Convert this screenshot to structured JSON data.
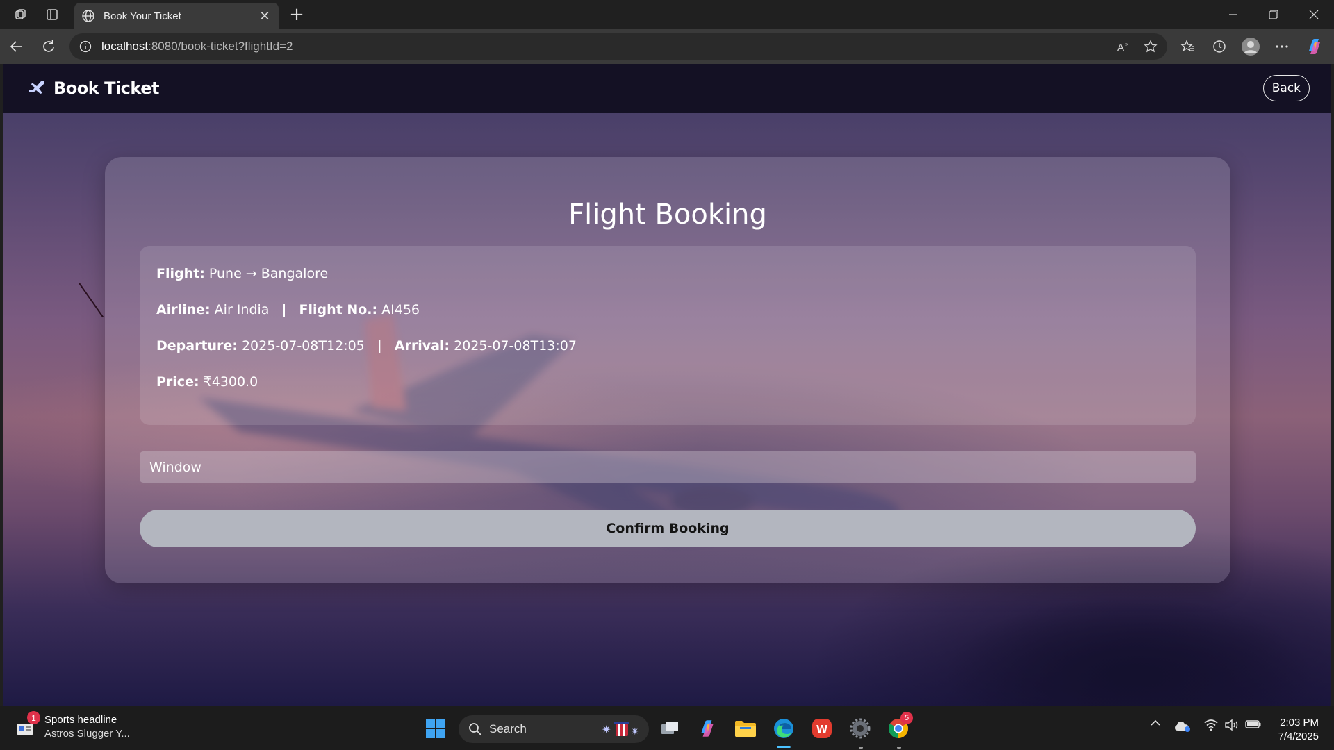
{
  "browser": {
    "tab_title": "Book Your Ticket",
    "url_host": "localhost",
    "url_rest": ":8080/book-ticket?flightId=2"
  },
  "navbar": {
    "brand": "Book Ticket",
    "back_label": "Back"
  },
  "card": {
    "title": "Flight Booking",
    "flight_label": "Flight:",
    "flight_value": "Pune → Bangalore",
    "airline_label": "Airline:",
    "airline_value": "Air India",
    "flight_no_label": "Flight No.:",
    "flight_no_value": "AI456",
    "departure_label": "Departure:",
    "departure_value": "2025-07-08T12:05",
    "arrival_label": "Arrival:",
    "arrival_value": "2025-07-08T13:07",
    "price_label": "Price:",
    "price_value": "₹4300.0",
    "separator": "|",
    "seat_selected": "Window",
    "confirm_label": "Confirm Booking"
  },
  "taskbar": {
    "news_badge": "1",
    "news_title": "Sports headline",
    "news_sub": "Astros Slugger Y...",
    "search_label": "Search",
    "chrome_badge": "5",
    "time": "2:03 PM",
    "date": "7/4/2025"
  },
  "colors": {
    "navbar_bg": "#141124",
    "confirm_bg": "#b3b6bf",
    "accent": "#4cc2ff"
  }
}
